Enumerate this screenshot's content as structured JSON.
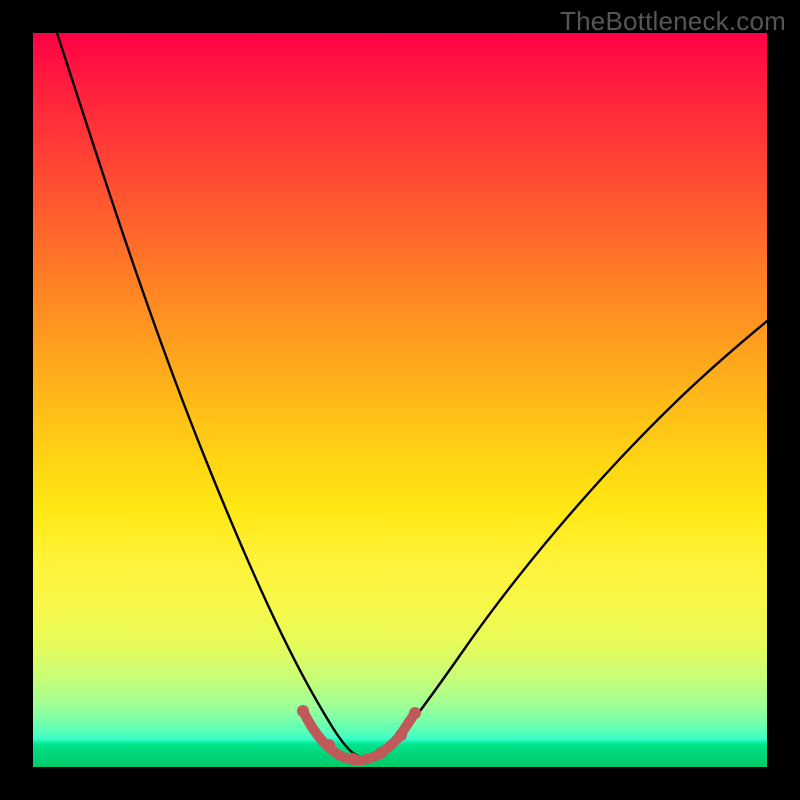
{
  "watermark": "TheBottleneck.com",
  "chart_data": {
    "type": "line",
    "title": "",
    "xlabel": "",
    "ylabel": "",
    "xlim": [
      0,
      100
    ],
    "ylim": [
      0,
      100
    ],
    "note": "Values are approximate; the chart has no visible axis ticks or numeric labels so x/y are normalized 0–100.",
    "series": [
      {
        "name": "bottleneck-curve",
        "color": "#000000",
        "x": [
          3,
          8,
          12,
          16,
          20,
          24,
          28,
          32,
          35,
          37,
          39,
          41,
          43,
          45,
          47,
          49,
          54,
          58,
          64,
          72,
          82,
          92,
          100
        ],
        "y": [
          100,
          90,
          80,
          70,
          60,
          50,
          41,
          32,
          24,
          18,
          12,
          7,
          4,
          2,
          2,
          4,
          9,
          14,
          22,
          32,
          43,
          52,
          58
        ]
      },
      {
        "name": "optimal-zone-overlay",
        "color": "#c05a5a",
        "x": [
          37,
          39,
          41,
          43,
          45,
          47,
          49,
          51
        ],
        "y": [
          8,
          4,
          2,
          1,
          1,
          2,
          4,
          8
        ]
      }
    ]
  },
  "colors": {
    "frame": "#000000",
    "watermark": "#565656",
    "curve": "#000000",
    "overlay": "#c05a5a"
  }
}
